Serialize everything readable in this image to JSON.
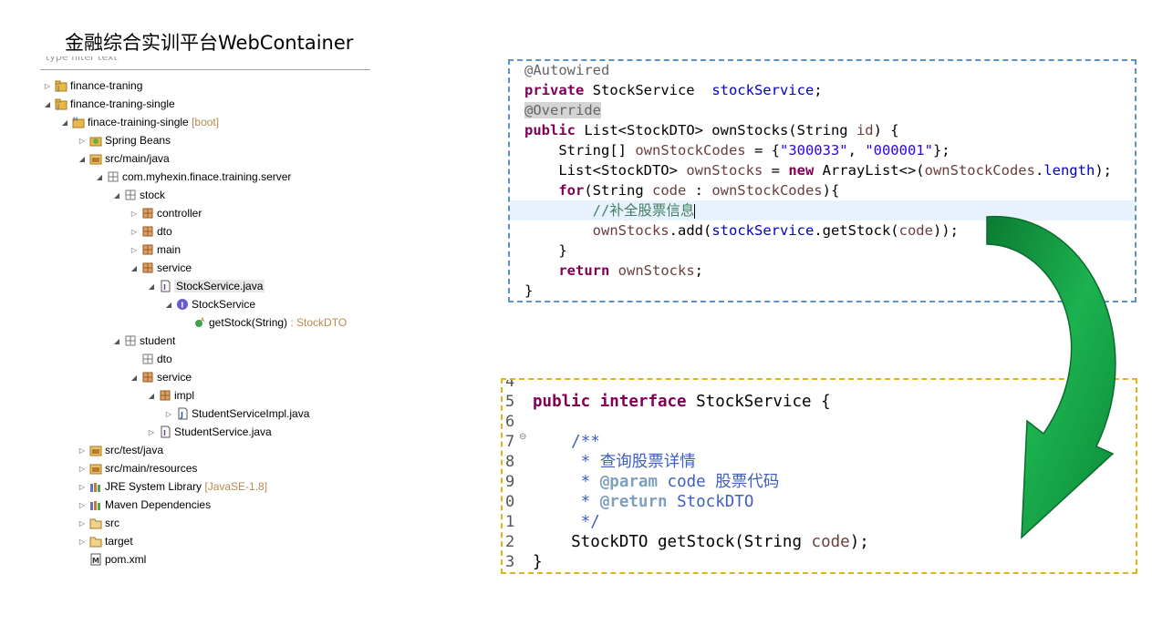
{
  "title": "金融综合实训平台WebContainer",
  "filter_placeholder": "type filter text",
  "tree": [
    {
      "label": "finance-traning",
      "indent": 0,
      "twisty": "closed",
      "icon": "project-icon"
    },
    {
      "label": "finance-traning-single",
      "indent": 0,
      "twisty": "open",
      "icon": "project-icon"
    },
    {
      "label": "finace-training-single",
      "decoration": "[boot]",
      "indent": 1,
      "twisty": "open",
      "icon": "maven-project-icon"
    },
    {
      "label": "Spring Beans",
      "indent": 2,
      "twisty": "closed",
      "icon": "spring-beans-icon"
    },
    {
      "label": "src/main/java",
      "indent": 2,
      "twisty": "open",
      "icon": "source-folder-icon"
    },
    {
      "label": "com.myhexin.finace.training.server",
      "indent": 3,
      "twisty": "open",
      "icon": "package-icon"
    },
    {
      "label": "stock",
      "indent": 4,
      "twisty": "open",
      "icon": "package-icon"
    },
    {
      "label": "controller",
      "indent": 5,
      "twisty": "closed",
      "icon": "package-filled-icon"
    },
    {
      "label": "dto",
      "indent": 5,
      "twisty": "closed",
      "icon": "package-filled-icon"
    },
    {
      "label": "main",
      "indent": 5,
      "twisty": "closed",
      "icon": "package-filled-icon"
    },
    {
      "label": "service",
      "indent": 5,
      "twisty": "open",
      "icon": "package-filled-icon"
    },
    {
      "label": "StockService.java",
      "indent": 6,
      "twisty": "open",
      "icon": "interface-file-icon",
      "selected": true
    },
    {
      "label": "StockService",
      "indent": 7,
      "twisty": "open",
      "icon": "interface-icon"
    },
    {
      "label": "getStock(String)",
      "decoration": ": StockDTO",
      "indent": 8,
      "twisty": "none",
      "icon": "method-icon"
    },
    {
      "label": "student",
      "indent": 4,
      "twisty": "open",
      "icon": "package-icon"
    },
    {
      "label": "dto",
      "indent": 5,
      "twisty": "none",
      "icon": "package-icon"
    },
    {
      "label": "service",
      "indent": 5,
      "twisty": "open",
      "icon": "package-filled-icon"
    },
    {
      "label": "impl",
      "indent": 6,
      "twisty": "open",
      "icon": "package-filled-icon"
    },
    {
      "label": "StudentServiceImpl.java",
      "indent": 7,
      "twisty": "closed",
      "icon": "java-file-icon"
    },
    {
      "label": "StudentService.java",
      "indent": 6,
      "twisty": "closed",
      "icon": "interface-file-icon"
    },
    {
      "label": "src/test/java",
      "indent": 2,
      "twisty": "closed",
      "icon": "source-folder-icon"
    },
    {
      "label": "src/main/resources",
      "indent": 2,
      "twisty": "closed",
      "icon": "source-folder-icon"
    },
    {
      "label": "JRE System Library",
      "decoration": "[JavaSE-1.8]",
      "indent": 2,
      "twisty": "closed",
      "icon": "library-icon"
    },
    {
      "label": "Maven Dependencies",
      "indent": 2,
      "twisty": "closed",
      "icon": "library-icon"
    },
    {
      "label": "src",
      "indent": 2,
      "twisty": "closed",
      "icon": "folder-icon"
    },
    {
      "label": "target",
      "indent": 2,
      "twisty": "closed",
      "icon": "folder-icon"
    },
    {
      "label": "pom.xml",
      "indent": 2,
      "twisty": "none",
      "icon": "maven-file-icon"
    }
  ],
  "code1": [
    [
      [
        "@Autowired",
        "ann"
      ]
    ],
    [
      [
        "private",
        "kw"
      ],
      [
        " StockService  ",
        ""
      ],
      [
        "stockService",
        "fld"
      ],
      [
        ";",
        ""
      ]
    ],
    [
      [
        "@Override",
        "ann-hl"
      ]
    ],
    [
      [
        "public",
        "kw"
      ],
      [
        " List<StockDTO> ownStocks(String ",
        ""
      ],
      [
        "id",
        "var"
      ],
      [
        ") {",
        ""
      ]
    ],
    [
      [
        "    String[] ",
        ""
      ],
      [
        "ownStockCodes",
        "var"
      ],
      [
        " = {",
        ""
      ],
      [
        "\"300033\"",
        "str"
      ],
      [
        ", ",
        ""
      ],
      [
        "\"000001\"",
        "str"
      ],
      [
        "};",
        ""
      ]
    ],
    [
      [
        "    List<StockDTO> ",
        ""
      ],
      [
        "ownStocks",
        "var"
      ],
      [
        " = ",
        ""
      ],
      [
        "new",
        "kw"
      ],
      [
        " ArrayList<>(",
        ""
      ],
      [
        "ownStockCodes",
        "var"
      ],
      [
        ".",
        ""
      ],
      [
        "length",
        "fld"
      ],
      [
        ");",
        ""
      ]
    ],
    [
      [
        "    ",
        ""
      ],
      [
        "for",
        "kw"
      ],
      [
        "(String ",
        ""
      ],
      [
        "code",
        "var"
      ],
      [
        " : ",
        ""
      ],
      [
        "ownStockCodes",
        "var"
      ],
      [
        "){",
        ""
      ]
    ],
    [
      [
        "        ",
        ""
      ],
      [
        "//补全股票信息",
        "cmt"
      ]
    ],
    [
      [
        "        ",
        ""
      ],
      [
        "ownStocks",
        "var"
      ],
      [
        ".add(",
        ""
      ],
      [
        "stockService",
        "fld"
      ],
      [
        ".getStock(",
        ""
      ],
      [
        "code",
        "var"
      ],
      [
        "));",
        ""
      ]
    ],
    [
      [
        "    }",
        ""
      ]
    ],
    [
      [
        "    ",
        ""
      ],
      [
        "return",
        "kw"
      ],
      [
        " ",
        ""
      ],
      [
        "ownStocks",
        "var"
      ],
      [
        ";",
        ""
      ]
    ],
    [
      [
        "}",
        ""
      ]
    ]
  ],
  "gutter2": [
    "4",
    "5",
    "6",
    "7",
    "8",
    "9",
    "0",
    "1",
    "2",
    "3"
  ],
  "code2": [
    [
      [
        "",
        ""
      ]
    ],
    [
      [
        "public",
        "kw"
      ],
      [
        " ",
        ""
      ],
      [
        "interface",
        "kw"
      ],
      [
        " StockService {",
        ""
      ]
    ],
    [
      [
        "",
        ""
      ]
    ],
    [
      [
        "    ",
        ""
      ],
      [
        "/**",
        "jd"
      ]
    ],
    [
      [
        "     * ",
        "jd"
      ],
      [
        "查询股票详情",
        "jd"
      ]
    ],
    [
      [
        "     * ",
        "jd"
      ],
      [
        "@param",
        "jdtag"
      ],
      [
        " ",
        ""
      ],
      [
        "code",
        "jd"
      ],
      [
        " 股票代码",
        "jd"
      ]
    ],
    [
      [
        "     * ",
        "jd"
      ],
      [
        "@return",
        "jdtag"
      ],
      [
        " ",
        ""
      ],
      [
        "StockDTO",
        "jd"
      ]
    ],
    [
      [
        "     */",
        "jd"
      ]
    ],
    [
      [
        "    StockDTO getStock(String ",
        ""
      ],
      [
        "code",
        "var"
      ],
      [
        ");",
        ""
      ]
    ],
    [
      [
        "}",
        ""
      ]
    ]
  ],
  "colors": {
    "box1_border": "#5a93cc",
    "box2_border": "#e0b418",
    "arrow": "#16a444"
  }
}
